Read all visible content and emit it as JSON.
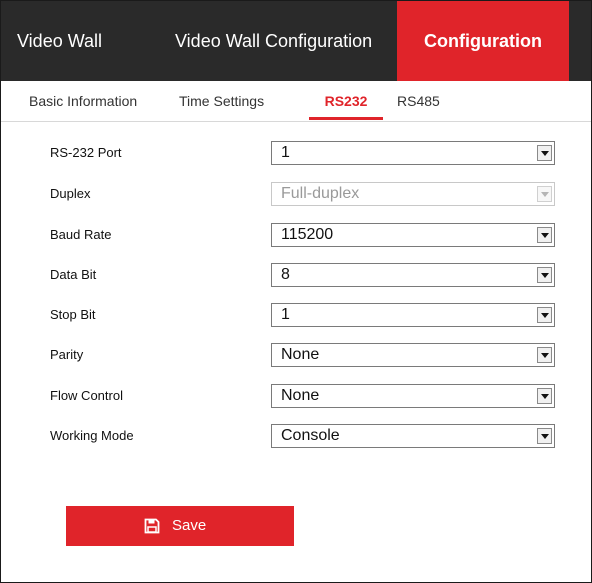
{
  "topnav": {
    "video_wall": "Video Wall",
    "video_wall_configuration": "Video Wall Configuration",
    "configuration": "Configuration"
  },
  "subtabs": {
    "basic_information": "Basic Information",
    "time_settings": "Time Settings",
    "rs232": "RS232",
    "rs485": "RS485"
  },
  "form": {
    "rows": [
      {
        "label": "RS-232 Port",
        "value": "1"
      },
      {
        "label": "Duplex",
        "value": "Full-duplex"
      },
      {
        "label": "Baud Rate",
        "value": "115200"
      },
      {
        "label": "Data Bit",
        "value": "8"
      },
      {
        "label": "Stop Bit",
        "value": "1"
      },
      {
        "label": "Parity",
        "value": "None"
      },
      {
        "label": "Flow Control",
        "value": "None"
      },
      {
        "label": "Working Mode",
        "value": "Console"
      }
    ]
  },
  "actions": {
    "save_label": "Save"
  },
  "colors": {
    "accent": "#e0242a",
    "topbar": "#2a2a2a"
  },
  "icons": {
    "save": "save-icon",
    "dropdown": "chevron-down-icon"
  }
}
